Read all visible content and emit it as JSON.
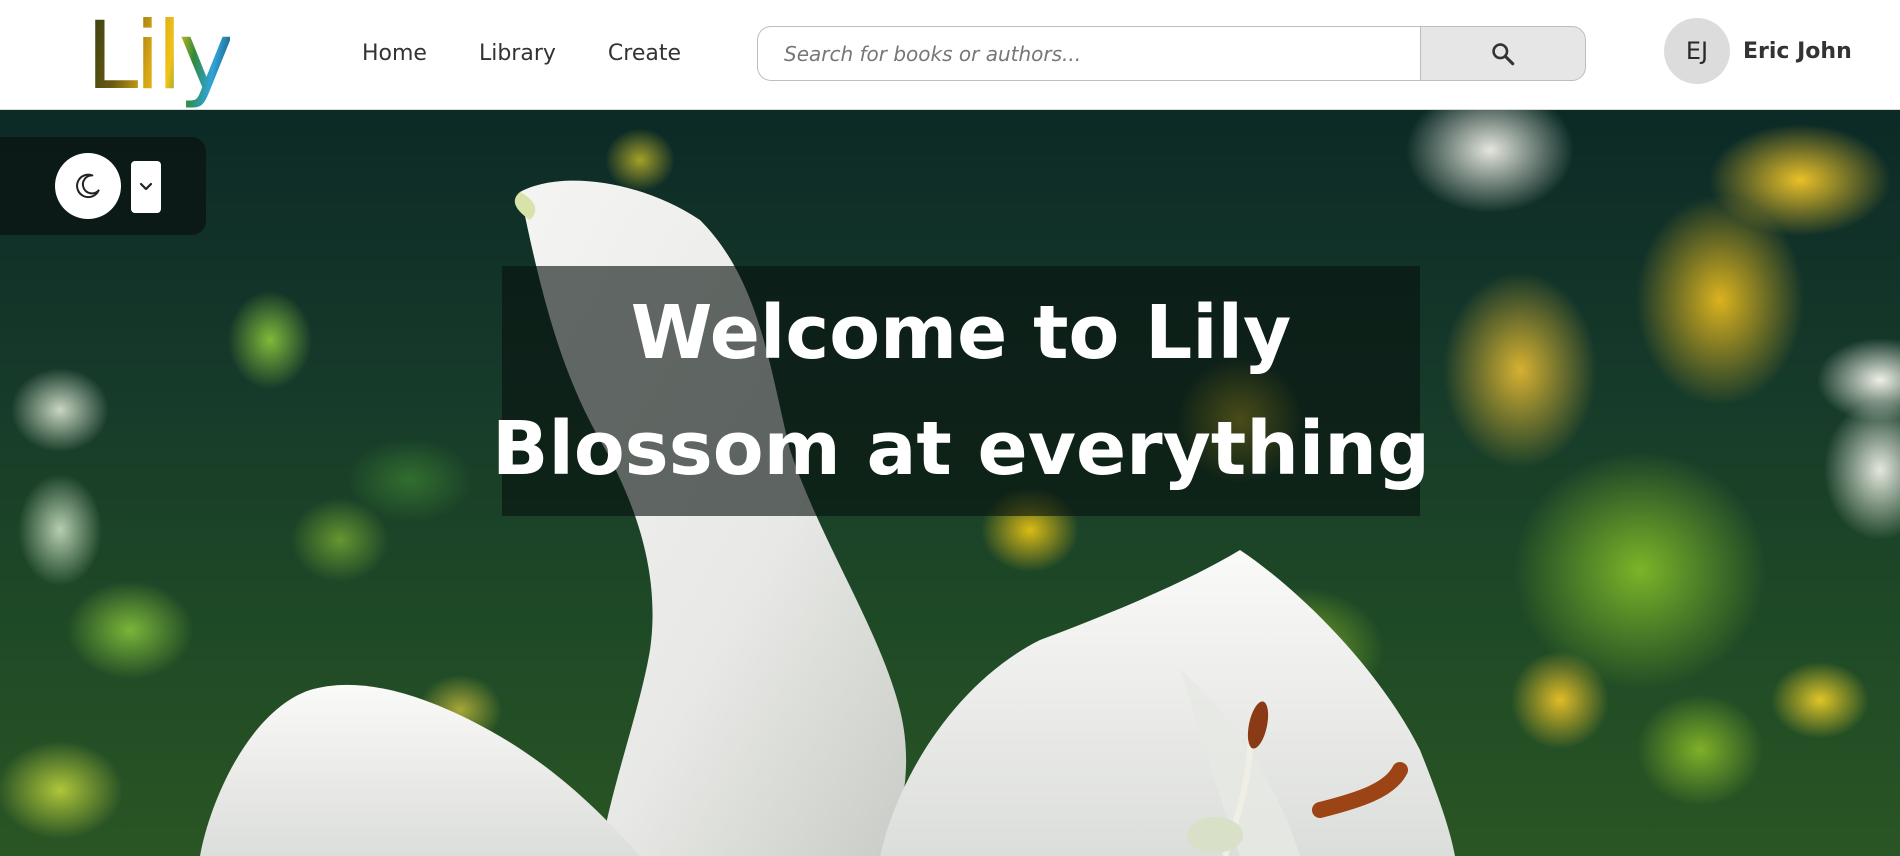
{
  "brand": {
    "logo_text": "Lily"
  },
  "nav": {
    "home": "Home",
    "library": "Library",
    "create": "Create"
  },
  "search": {
    "placeholder": "Search for books or authors...",
    "value": "",
    "button_icon": "search-icon"
  },
  "user": {
    "initials": "EJ",
    "name": "Eric John"
  },
  "theme": {
    "toggle_icon": "moon-icon",
    "dropdown_icon": "chevron-down-icon"
  },
  "hero": {
    "line1": "Welcome to Lily",
    "line2": "Blossom at everything"
  },
  "colors": {
    "header_bg": "#ffffff",
    "text_dark": "#333333",
    "avatar_bg": "#dcdcdc",
    "search_button_bg": "#e6e6e6"
  }
}
